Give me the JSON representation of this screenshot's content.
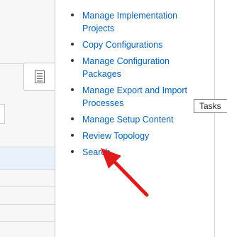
{
  "tasks_panel": {
    "items": [
      {
        "label": "Manage Implementation Projects"
      },
      {
        "label": "Copy Configurations"
      },
      {
        "label": "Manage Configuration Packages"
      },
      {
        "label": "Manage Export and Import Processes"
      },
      {
        "label": "Manage Setup Content"
      },
      {
        "label": "Review Topology"
      },
      {
        "label": "Search"
      }
    ],
    "tab_icon": "tasks-list-icon"
  },
  "tooltip": {
    "text": "Tasks"
  },
  "annotation": {
    "icon": "red-arrow-icon",
    "color": "#e01b1b"
  },
  "colors": {
    "link": "#0e5fa8",
    "selected_row": "#e9f1fa"
  }
}
